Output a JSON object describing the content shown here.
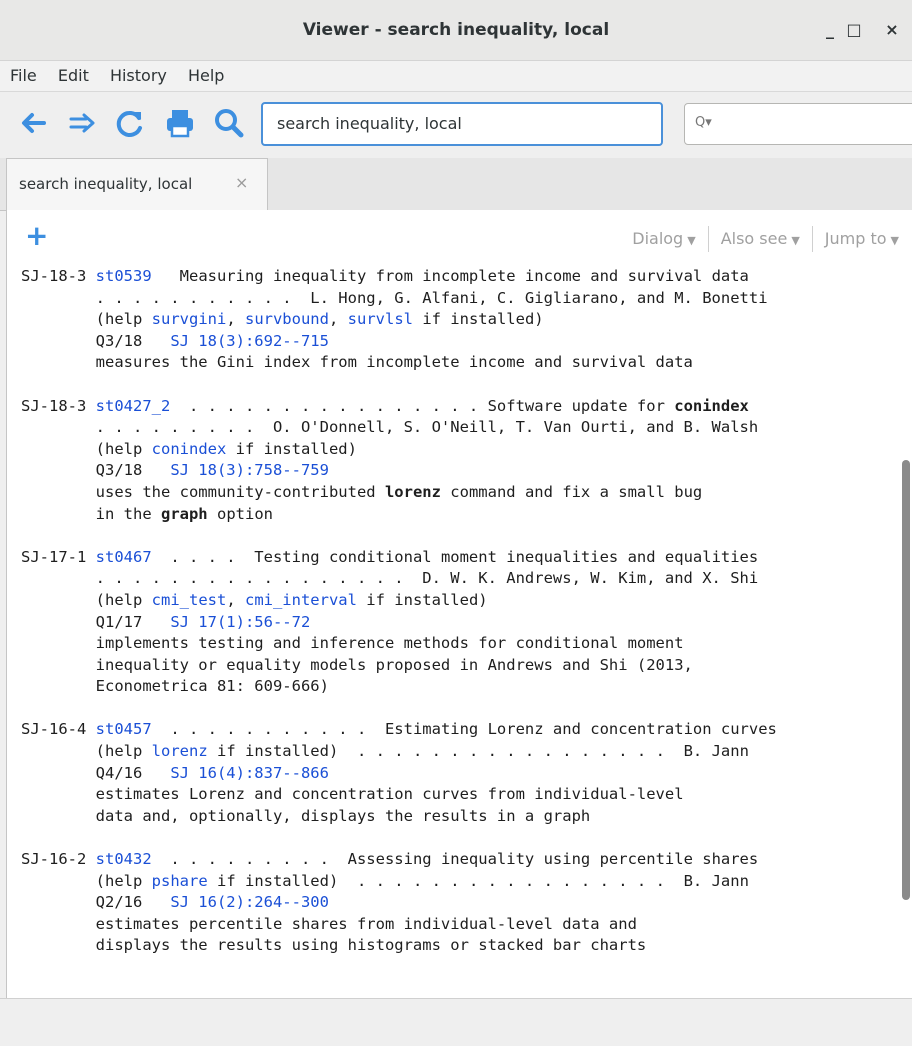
{
  "window": {
    "title": "Viewer - search inequality, local",
    "controls": [
      "_",
      "□",
      "×"
    ]
  },
  "menu": [
    "File",
    "Edit",
    "History",
    "Help"
  ],
  "toolbar": {
    "url_value": "search inequality, local",
    "search_placeholder": "Q▾"
  },
  "tabs": [
    {
      "label": "search inequality, local",
      "close": "×"
    }
  ],
  "content_toolbar": {
    "add_label": "+",
    "dialog": "Dialog",
    "also_see": "Also see",
    "jump_to": "Jump to"
  },
  "entries": [
    {
      "lines": [
        [
          {
            "t": "SJ-18-3 "
          },
          {
            "t": "st0539",
            "k": "link"
          },
          {
            "t": "   Measuring inequality from incomplete income and survival data"
          }
        ],
        [
          {
            "t": "        . . . . . . . . . . .  L. Hong, G. Alfani, C. Gigliarano, and M. Bonetti"
          }
        ],
        [
          {
            "t": "        (help "
          },
          {
            "t": "survgini",
            "k": "link"
          },
          {
            "t": ", "
          },
          {
            "t": "survbound",
            "k": "link"
          },
          {
            "t": ", "
          },
          {
            "t": "survlsl",
            "k": "link"
          },
          {
            "t": " if installed)"
          }
        ],
        [
          {
            "t": "        Q3/18   "
          },
          {
            "t": "SJ 18(3):692--715",
            "k": "link"
          }
        ],
        [
          {
            "t": "        measures the Gini index from incomplete income and survival data"
          }
        ]
      ]
    },
    {
      "lines": [
        [
          {
            "t": "SJ-18-3 "
          },
          {
            "t": "st0427_2",
            "k": "link"
          },
          {
            "t": "  . . . . . . . . . . . . . . . . Software update for "
          },
          {
            "t": "conindex",
            "k": "bold"
          }
        ],
        [
          {
            "t": "        . . . . . . . . .  O. O'Donnell, S. O'Neill, T. Van Ourti, and B. Walsh"
          }
        ],
        [
          {
            "t": "        (help "
          },
          {
            "t": "conindex",
            "k": "link"
          },
          {
            "t": " if installed)"
          }
        ],
        [
          {
            "t": "        Q3/18   "
          },
          {
            "t": "SJ 18(3):758--759",
            "k": "link"
          }
        ],
        [
          {
            "t": "        uses the community-contributed "
          },
          {
            "t": "lorenz",
            "k": "bold"
          },
          {
            "t": " command and fix a small bug"
          }
        ],
        [
          {
            "t": "        in the "
          },
          {
            "t": "graph",
            "k": "bold"
          },
          {
            "t": " option"
          }
        ]
      ]
    },
    {
      "lines": [
        [
          {
            "t": "SJ-17-1 "
          },
          {
            "t": "st0467",
            "k": "link"
          },
          {
            "t": "  . . . .  Testing conditional moment inequalities and equalities"
          }
        ],
        [
          {
            "t": "        . . . . . . . . . . . . . . . . .  D. W. K. Andrews, W. Kim, and X. Shi"
          }
        ],
        [
          {
            "t": "        (help "
          },
          {
            "t": "cmi_test",
            "k": "link"
          },
          {
            "t": ", "
          },
          {
            "t": "cmi_interval",
            "k": "link"
          },
          {
            "t": " if installed)"
          }
        ],
        [
          {
            "t": "        Q1/17   "
          },
          {
            "t": "SJ 17(1):56--72",
            "k": "link"
          }
        ],
        [
          {
            "t": "        implements testing and inference methods for conditional moment"
          }
        ],
        [
          {
            "t": "        inequality or equality models proposed in Andrews and Shi (2013,"
          }
        ],
        [
          {
            "t": "        Econometrica 81: 609-666)"
          }
        ]
      ]
    },
    {
      "lines": [
        [
          {
            "t": "SJ-16-4 "
          },
          {
            "t": "st0457",
            "k": "link"
          },
          {
            "t": "  . . . . . . . . . . .  Estimating Lorenz and concentration curves"
          }
        ],
        [
          {
            "t": "        (help "
          },
          {
            "t": "lorenz",
            "k": "link"
          },
          {
            "t": " if installed)  . . . . . . . . . . . . . . . . .  B. Jann"
          }
        ],
        [
          {
            "t": "        Q4/16   "
          },
          {
            "t": "SJ 16(4):837--866",
            "k": "link"
          }
        ],
        [
          {
            "t": "        estimates Lorenz and concentration curves from individual-level"
          }
        ],
        [
          {
            "t": "        data and, optionally, displays the results in a graph"
          }
        ]
      ]
    },
    {
      "lines": [
        [
          {
            "t": "SJ-16-2 "
          },
          {
            "t": "st0432",
            "k": "link"
          },
          {
            "t": "  . . . . . . . . .  Assessing inequality using percentile shares"
          }
        ],
        [
          {
            "t": "        (help "
          },
          {
            "t": "pshare",
            "k": "link"
          },
          {
            "t": " if installed)  . . . . . . . . . . . . . . . . .  B. Jann"
          }
        ],
        [
          {
            "t": "        Q2/16   "
          },
          {
            "t": "SJ 16(2):264--300",
            "k": "link"
          }
        ],
        [
          {
            "t": "        estimates percentile shares from individual-level data and"
          }
        ],
        [
          {
            "t": "        displays the results using histograms or stacked bar charts"
          }
        ]
      ]
    }
  ]
}
